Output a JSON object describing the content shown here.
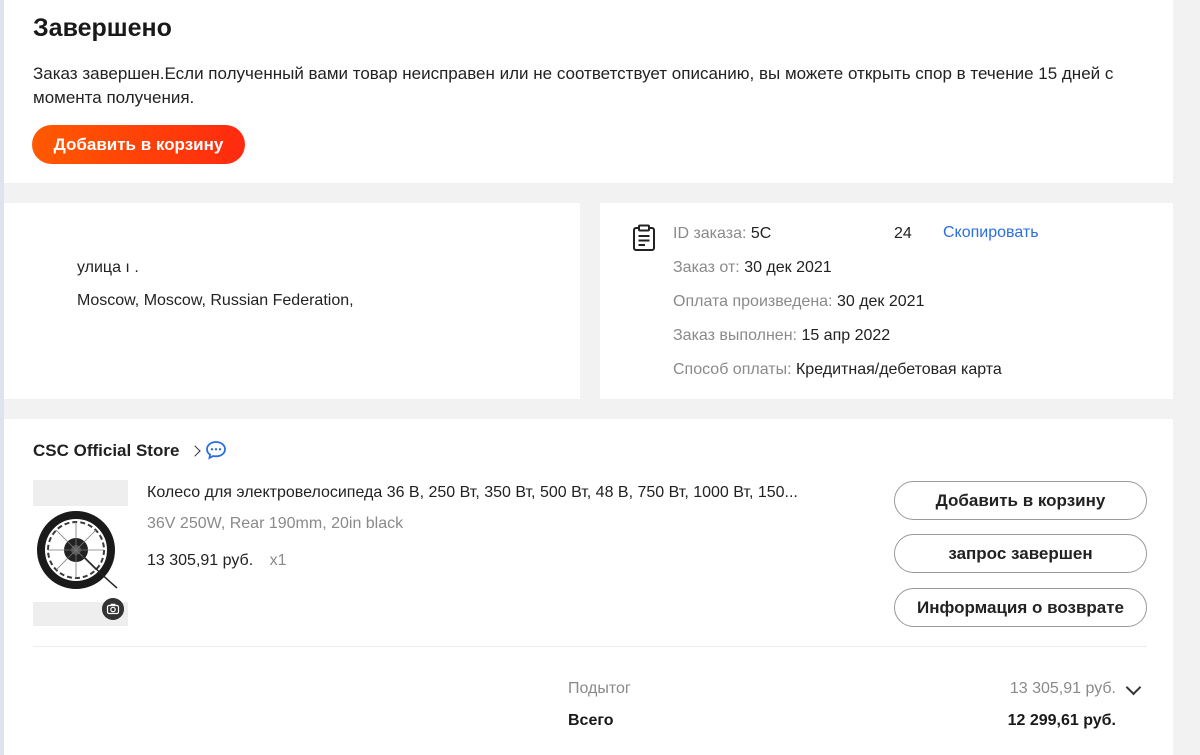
{
  "status": {
    "title": "Завершено",
    "description": "Заказ завершен.Если полученный вами товар неисправен или не соответствует описанию, вы можете открыть спор в течение 15 дней с момента получения.",
    "add_to_cart_label": "Добавить в корзину"
  },
  "address": {
    "street": "улица ı .",
    "city_line": "Moscow, Moscow, Russian Federation,"
  },
  "order_info": {
    "order_id_label": "ID заказа:",
    "order_id_value": "5C",
    "order_id_tail": "24",
    "copy_label": "Скопировать",
    "ordered_label": "Заказ от:",
    "ordered_value": "30 дек 2021",
    "paid_label": "Оплата произведена:",
    "paid_value": "30 дек 2021",
    "completed_label": "Заказ выполнен:",
    "completed_value": "15 апр 2022",
    "payment_label": "Способ оплаты:",
    "payment_value": "Кредитная/дебетовая карта"
  },
  "store": {
    "name": "CSC Official Store",
    "icons": {
      "chevron": "chevron-right-icon",
      "chat": "chat-icon"
    }
  },
  "product": {
    "title": "Колесо для электровелосипеда 36 В, 250 Вт, 350 Вт, 500 Вт, 48 В, 750 Вт, 1000 Вт, 150...",
    "variant": "36V 250W, Rear 190mm, 20in black",
    "price": "13 305,91 руб.",
    "quantity": "x1"
  },
  "actions": {
    "add_to_cart": "Добавить в корзину",
    "request_completed": "запрос завершен",
    "return_info": "Информация о возврате"
  },
  "summary": {
    "subtotal_label": "Подытог",
    "subtotal_value": "13 305,91 руб.",
    "total_label": "Всего",
    "total_value": "12 299,61 руб."
  },
  "colors": {
    "accent": "#ff4a06",
    "link": "#2a6fe0",
    "muted": "#8a8a8a"
  }
}
